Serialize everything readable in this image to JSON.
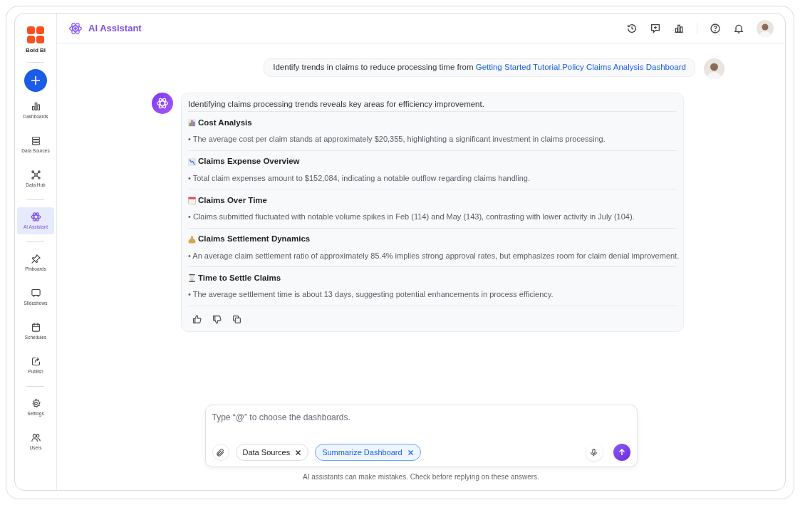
{
  "brand": {
    "name": "Bold BI"
  },
  "sidebar": {
    "groups": [
      {
        "items": [
          {
            "label": "Dashboards",
            "selected": false
          },
          {
            "label": "Data Sources",
            "selected": false
          },
          {
            "label": "Data Hub",
            "selected": false
          }
        ]
      },
      {
        "items": [
          {
            "label": "AI Assistant",
            "selected": true
          }
        ]
      },
      {
        "items": [
          {
            "label": "Pinboards",
            "selected": false
          },
          {
            "label": "Slideshows",
            "selected": false
          },
          {
            "label": "Schedules",
            "selected": false
          },
          {
            "label": "Publish",
            "selected": false
          }
        ]
      },
      {
        "items": [
          {
            "label": "Settings",
            "selected": false
          },
          {
            "label": "Users",
            "selected": false
          }
        ]
      }
    ]
  },
  "header": {
    "title": "AI Assistant"
  },
  "conversation": {
    "user_message": {
      "text": "Identify trends in claims to reduce processing time from ",
      "link": "Getting Started Tutorial.Policy Claims Analysis Dashboard"
    },
    "reply": {
      "intro": "Identifying claims processing trends reveals key areas for efficiency improvement.",
      "sections": [
        {
          "kind": "bar-chart",
          "title": "Cost Analysis",
          "text": "• The average cost per claim stands at approximately $20,355, highlighting a significant investment in claims processing."
        },
        {
          "kind": "down-chart",
          "title": "Claims Expense Overview",
          "text": "• Total claim expenses amount to $152,084, indicating a notable outflow regarding claims handling."
        },
        {
          "kind": "calendar",
          "title": "Claims Over Time",
          "text": "• Claims submitted fluctuated with notable volume spikes in Feb (114) and May (143), contrasting with lower activity in July (104)."
        },
        {
          "kind": "money-bag",
          "title": "Claims Settlement Dynamics",
          "text": "• An average claim settlement ratio of approximately 85.4% implies strong approval rates, but emphasizes room for claim denial improvement."
        },
        {
          "kind": "hourglass",
          "title": "Time to Settle Claims",
          "text": "• The average settlement time is about 13 days, suggesting potential enhancements in process efficiency."
        }
      ]
    }
  },
  "composer": {
    "placeholder": "Type “@” to choose the dashboards.",
    "chips": [
      {
        "label": "Data Sources",
        "selected": false
      },
      {
        "label": "Summarize Dashboard",
        "selected": true
      }
    ]
  },
  "disclaimer": "AI assistants can make mistakes. Check before replying on these answers."
}
